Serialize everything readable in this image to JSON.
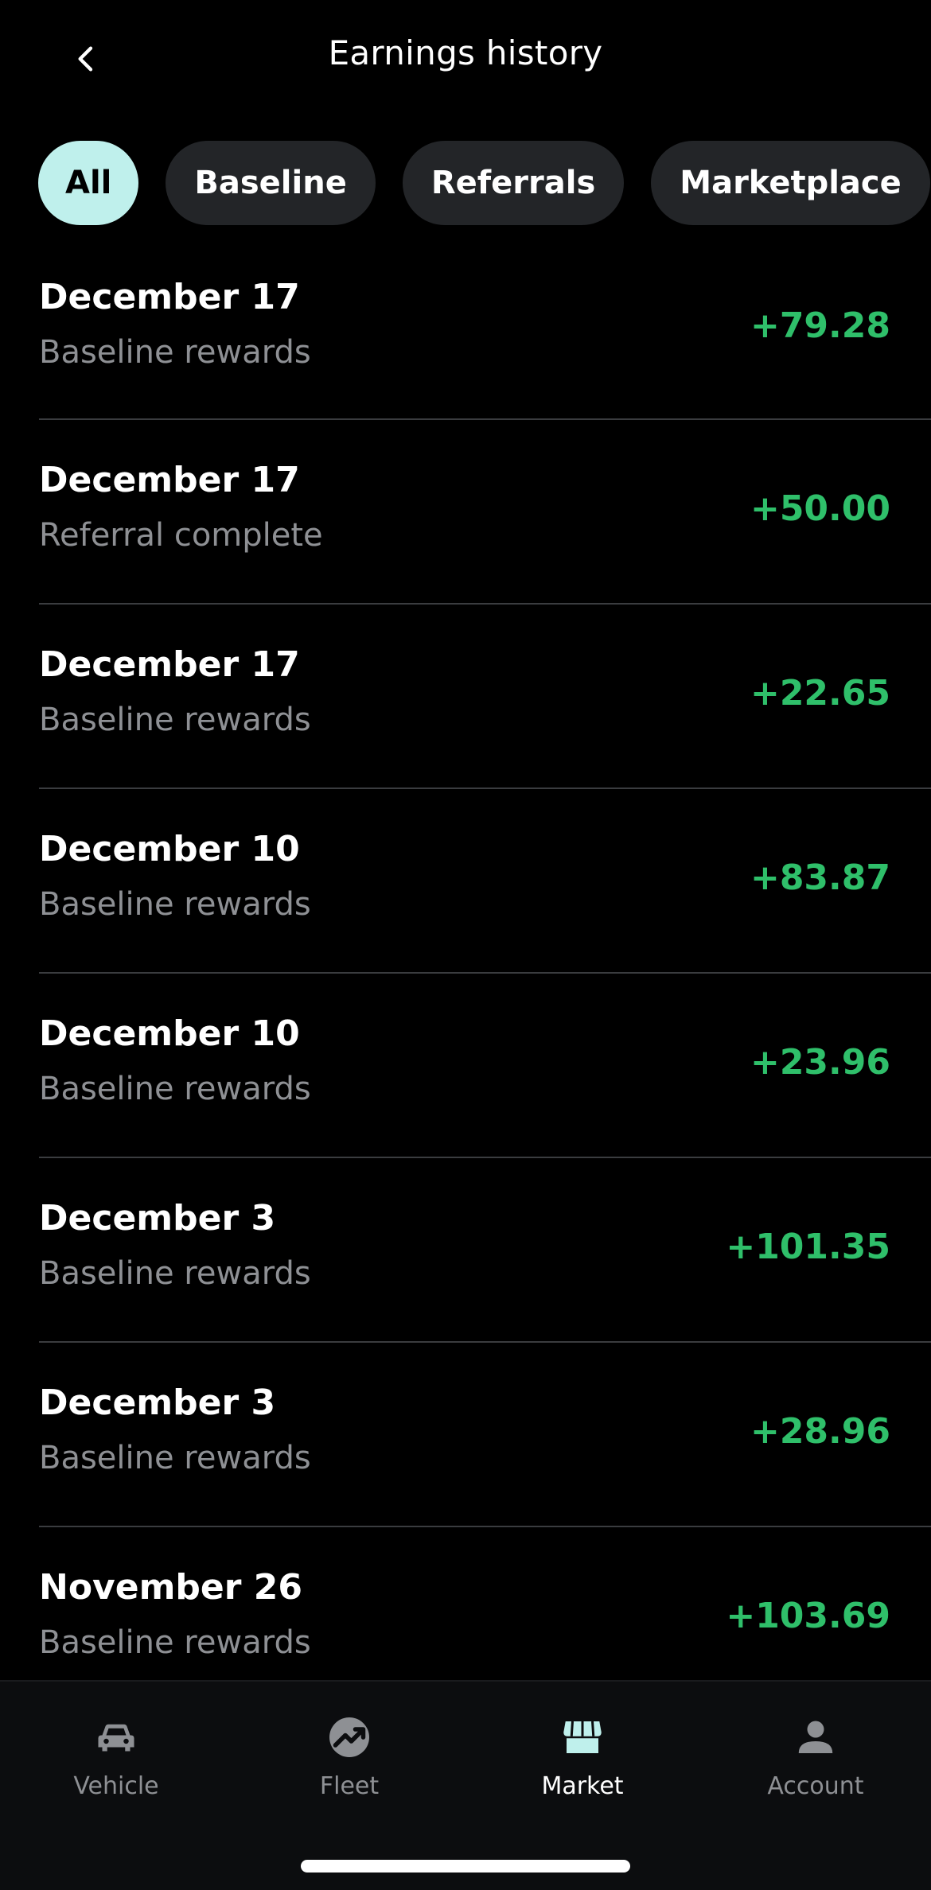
{
  "header": {
    "title": "Earnings history",
    "back_icon": "chevron-left-icon"
  },
  "filters": [
    {
      "label": "All",
      "active": true
    },
    {
      "label": "Baseline",
      "active": false
    },
    {
      "label": "Referrals",
      "active": false
    },
    {
      "label": "Marketplace",
      "active": false
    }
  ],
  "earnings": [
    {
      "date": "December 17",
      "description": "Baseline rewards",
      "amount": "+79.28"
    },
    {
      "date": "December 17",
      "description": "Referral complete",
      "amount": "+50.00"
    },
    {
      "date": "December 17",
      "description": "Baseline rewards",
      "amount": "+22.65"
    },
    {
      "date": "December 10",
      "description": "Baseline rewards",
      "amount": "+83.87"
    },
    {
      "date": "December 10",
      "description": "Baseline rewards",
      "amount": "+23.96"
    },
    {
      "date": "December 3",
      "description": "Baseline rewards",
      "amount": "+101.35"
    },
    {
      "date": "December 3",
      "description": "Baseline rewards",
      "amount": "+28.96"
    },
    {
      "date": "November 26",
      "description": "Baseline rewards",
      "amount": "+103.69"
    }
  ],
  "tabbar": [
    {
      "label": "Vehicle",
      "icon": "car-icon",
      "active": false
    },
    {
      "label": "Fleet",
      "icon": "trending-chart-icon",
      "active": false
    },
    {
      "label": "Market",
      "icon": "storefront-icon",
      "active": true
    },
    {
      "label": "Account",
      "icon": "person-icon",
      "active": false
    }
  ],
  "colors": {
    "background": "#000000",
    "chip": "#232528",
    "chip_active": "#bff0ec",
    "amount_positive": "#2fbf6a",
    "secondary_text": "#8e9094",
    "active_icon": "#bff0ec"
  }
}
